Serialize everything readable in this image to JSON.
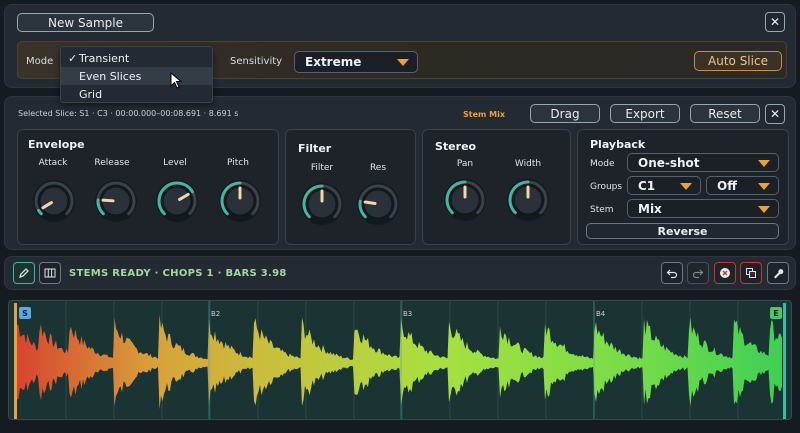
{
  "top": {
    "new_sample": "New Sample",
    "mode_label": "Mode",
    "sensitivity_label": "Sensitivity",
    "sensitivity_value": "Extreme",
    "auto_slice": "Auto Slice",
    "close": "✕",
    "menu": {
      "items": [
        {
          "label": "Transient",
          "checked": true
        },
        {
          "label": "Even Slices",
          "checked": false
        },
        {
          "label": "Grid",
          "checked": false
        }
      ]
    }
  },
  "slice": {
    "info": "Selected Slice: S1 · C3 · 00:00.000–00:08.691 · 8.691 s",
    "stem_mix": "Stem Mix",
    "drag": "Drag",
    "export": "Export",
    "reset": "Reset",
    "close": "✕",
    "envelope": {
      "title": "Envelope",
      "knobs": [
        {
          "label": "Attack",
          "value": 0.05
        },
        {
          "label": "Release",
          "value": 0.18
        },
        {
          "label": "Level",
          "value": 0.72
        },
        {
          "label": "Pitch",
          "value": 0.5
        }
      ]
    },
    "filter": {
      "title": "Filter",
      "knobs": [
        {
          "label": "Filter",
          "value": 0.5
        },
        {
          "label": "Res",
          "value": 0.2
        }
      ]
    },
    "stereo": {
      "title": "Stereo",
      "knobs": [
        {
          "label": "Pan",
          "value": 0.5
        },
        {
          "label": "Width",
          "value": 0.5
        }
      ]
    },
    "playback": {
      "title": "Playback",
      "mode_label": "Mode",
      "mode_value": "One-shot",
      "groups_label": "Groups",
      "groups_value": "C1",
      "groups_extra": "Off",
      "stem_label": "Stem",
      "stem_value": "Mix",
      "reverse": "Reverse"
    }
  },
  "toolbar": {
    "status": "STEMS READY   ·   CHOPS 1   ·   BARS 3.98"
  },
  "wave": {
    "bars": [
      "B2",
      "B3",
      "B4"
    ],
    "start_marker": "S",
    "end_marker": "E"
  },
  "colors": {
    "accent": "#3fb8a0",
    "orange": "#e7a23a",
    "red": "#c0392b"
  }
}
